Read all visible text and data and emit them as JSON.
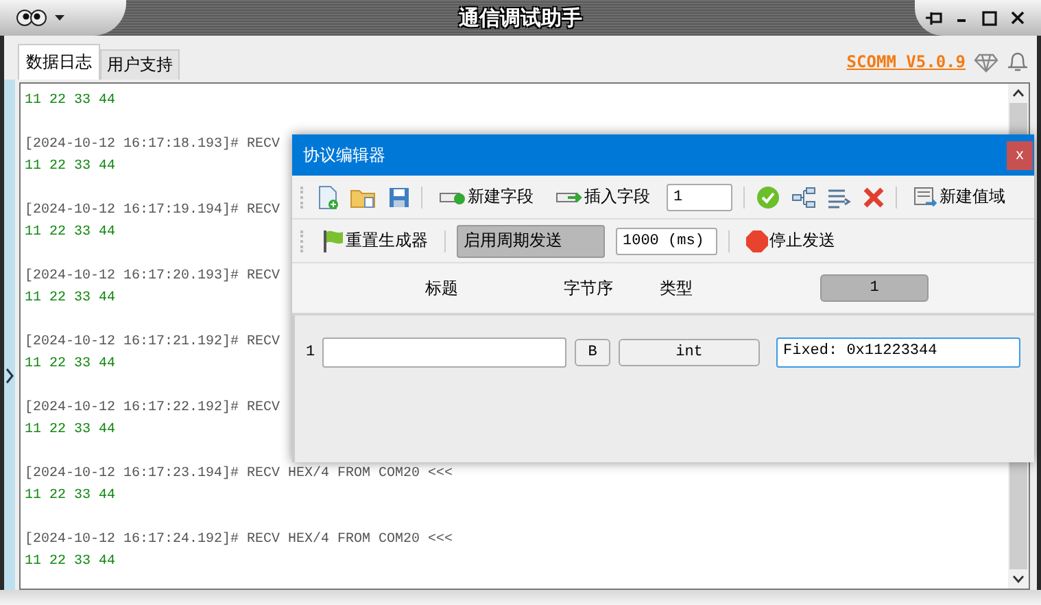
{
  "window": {
    "title": "通信调试助手"
  },
  "tabs": [
    {
      "label": "数据日志",
      "selected": true
    },
    {
      "label": "用户支持",
      "selected": false
    }
  ],
  "version_link": "SCOMM V5.0.9",
  "log": [
    {
      "kind": "data",
      "text": "11 22 33 44"
    },
    {
      "kind": "header",
      "text": "[2024-10-12 16:17:18.193]# RECV"
    },
    {
      "kind": "data",
      "text": "11 22 33 44"
    },
    {
      "kind": "header",
      "text": "[2024-10-12 16:17:19.194]# RECV"
    },
    {
      "kind": "data",
      "text": "11 22 33 44"
    },
    {
      "kind": "header",
      "text": "[2024-10-12 16:17:20.193]# RECV"
    },
    {
      "kind": "data",
      "text": "11 22 33 44"
    },
    {
      "kind": "header",
      "text": "[2024-10-12 16:17:21.192]# RECV"
    },
    {
      "kind": "data",
      "text": "11 22 33 44"
    },
    {
      "kind": "header",
      "text": "[2024-10-12 16:17:22.192]# RECV"
    },
    {
      "kind": "data",
      "text": "11 22 33 44"
    },
    {
      "kind": "header",
      "text": "[2024-10-12 16:17:23.194]# RECV HEX/4 FROM COM20 <<<"
    },
    {
      "kind": "data",
      "text": "11 22 33 44"
    },
    {
      "kind": "header",
      "text": "[2024-10-12 16:17:24.192]# RECV HEX/4 FROM COM20 <<<"
    },
    {
      "kind": "data",
      "text": "11 22 33 44"
    }
  ],
  "dialog": {
    "title": "协议编辑器",
    "close": "x",
    "toolbar1": {
      "new_field": "新建字段",
      "insert_field": "插入字段",
      "count": "1",
      "new_range": "新建值域"
    },
    "toolbar2": {
      "reset": "重置生成器",
      "periodic": {
        "label": "启用周期发送",
        "selected": true
      },
      "interval": "1000 (ms)",
      "stop": "停止发送"
    },
    "columns": [
      "标题",
      "字节序",
      "类型"
    ],
    "column_button": "1",
    "rows": [
      {
        "index": "1",
        "byte_order": "B",
        "type": "int",
        "value": "Fixed: 0x11223344"
      }
    ]
  }
}
